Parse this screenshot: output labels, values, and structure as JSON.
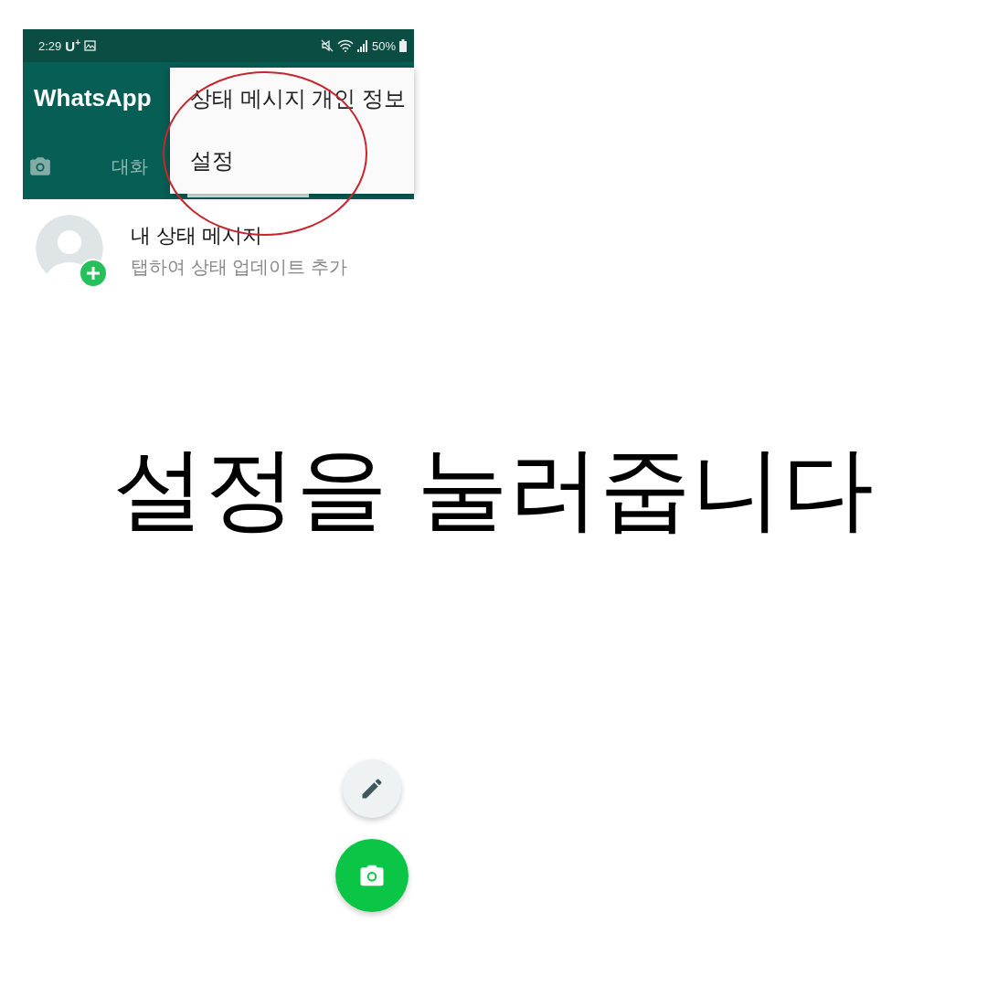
{
  "status_bar": {
    "time": "2:29",
    "carrier": "U$^{+}$",
    "battery": "50%"
  },
  "app_bar": {
    "title": "WhatsApp"
  },
  "tabs": [
    {
      "label": "대화",
      "selected": false
    }
  ],
  "menu": {
    "items": [
      "상태 메시지 개인 정보",
      "설정"
    ]
  },
  "my_status": {
    "title": "내 상태 메시지",
    "subtitle": "탭하여 상태 업데이트 추가"
  },
  "caption": "설정을 눌러줍니다"
}
